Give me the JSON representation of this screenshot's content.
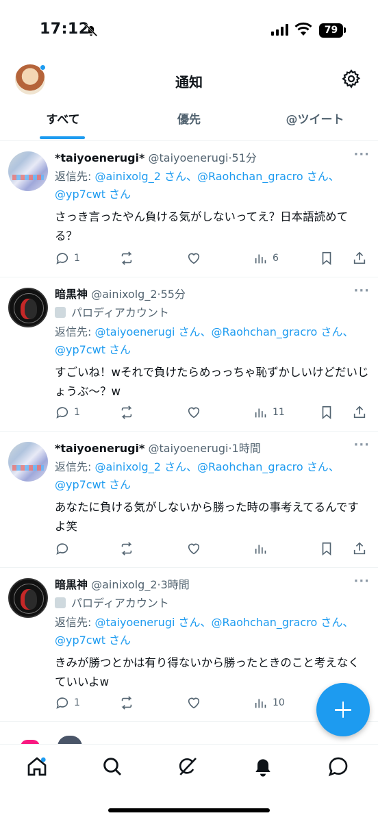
{
  "status_bar": {
    "time": "17:12",
    "battery": "79"
  },
  "header": {
    "title": "通知"
  },
  "tabs": [
    {
      "label": "すべて"
    },
    {
      "label": "優先"
    },
    {
      "label": "@ツイート"
    }
  ],
  "tweets": [
    {
      "name": "*taiyoenerugi*",
      "handle": "@taiyoenerugi",
      "time": "51分",
      "label": "",
      "reply_prefix": "返信先: ",
      "reply_links": "@ainixolg_2 さん、@Raohchan_gracro さん、@yp7cwt さん",
      "text": "さっき言ったやん負ける気がしないってえ？日本語読めてる？",
      "replies": "1",
      "views": "6"
    },
    {
      "name": "暗黒神",
      "handle": "@ainixolg_2",
      "time": "55分",
      "label": "パロディアカウント",
      "reply_prefix": "返信先: ",
      "reply_links": "@taiyoenerugi さん、@Raohchan_gracro さん、@yp7cwt さん",
      "text": "すごいね！wそれで負けたらめっっちゃ恥ずかしいけどだいじょうぶ〜？w",
      "replies": "1",
      "views": "11"
    },
    {
      "name": "*taiyoenerugi*",
      "handle": "@taiyoenerugi",
      "time": "1時間",
      "label": "",
      "reply_prefix": "返信先: ",
      "reply_links": "@ainixolg_2 さん、@Raohchan_gracro さん、@yp7cwt さん",
      "text": "あなたに負ける気がしないから勝った時の事考えてるんですよ笑",
      "replies": "",
      "views": ""
    },
    {
      "name": "暗黒神",
      "handle": "@ainixolg_2",
      "time": "3時間",
      "label": "パロディアカウント",
      "reply_prefix": "返信先: ",
      "reply_links": "@taiyoenerugi さん、@Raohchan_gracro さん、@yp7cwt さん",
      "text": "きみが勝つとかは有り得ないから勝ったときのこと考えなくていいよw",
      "replies": "1",
      "views": "10"
    }
  ],
  "colors": {
    "accent": "#1d9bf0",
    "text": "#0f1419",
    "muted": "#536471",
    "like_pink": "#f91880"
  },
  "nav_icons": [
    "home-icon",
    "search-icon",
    "grok-icon",
    "notifications-icon",
    "messages-icon"
  ]
}
